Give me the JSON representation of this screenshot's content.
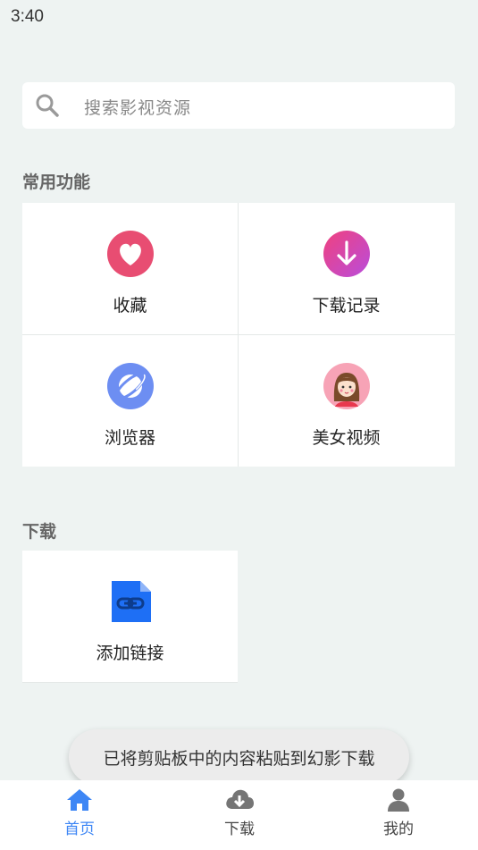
{
  "status_bar": {
    "time": "3:40"
  },
  "search": {
    "placeholder": "搜索影视资源",
    "icon": "search-icon"
  },
  "common": {
    "title": "常用功能",
    "items": [
      {
        "label": "收藏",
        "icon": "heart-icon"
      },
      {
        "label": "下载记录",
        "icon": "download-arrow-icon"
      },
      {
        "label": "浏览器",
        "icon": "planet-icon"
      },
      {
        "label": "美女视频",
        "icon": "girl-avatar-icon"
      }
    ]
  },
  "download": {
    "title": "下载",
    "items": [
      {
        "label": "添加链接",
        "icon": "link-file-icon"
      }
    ]
  },
  "toast": {
    "message": "已将剪贴板中的内容粘贴到幻影下载"
  },
  "bottom_nav": {
    "items": [
      {
        "label": "首页",
        "icon": "home-icon",
        "active": true
      },
      {
        "label": "下载",
        "icon": "cloud-download-icon",
        "active": false
      },
      {
        "label": "我的",
        "icon": "user-icon",
        "active": false
      }
    ]
  },
  "colors": {
    "accent": "#3d86f5",
    "inactive": "#6f6f6f",
    "background": "#eef3f2",
    "heart_bg": "#e84d72",
    "download_bg_start": "#f0417e",
    "download_bg_end": "#b94ddc",
    "planet_bg": "#6d8ef2",
    "link_file_bg": "#1e6ff5"
  }
}
